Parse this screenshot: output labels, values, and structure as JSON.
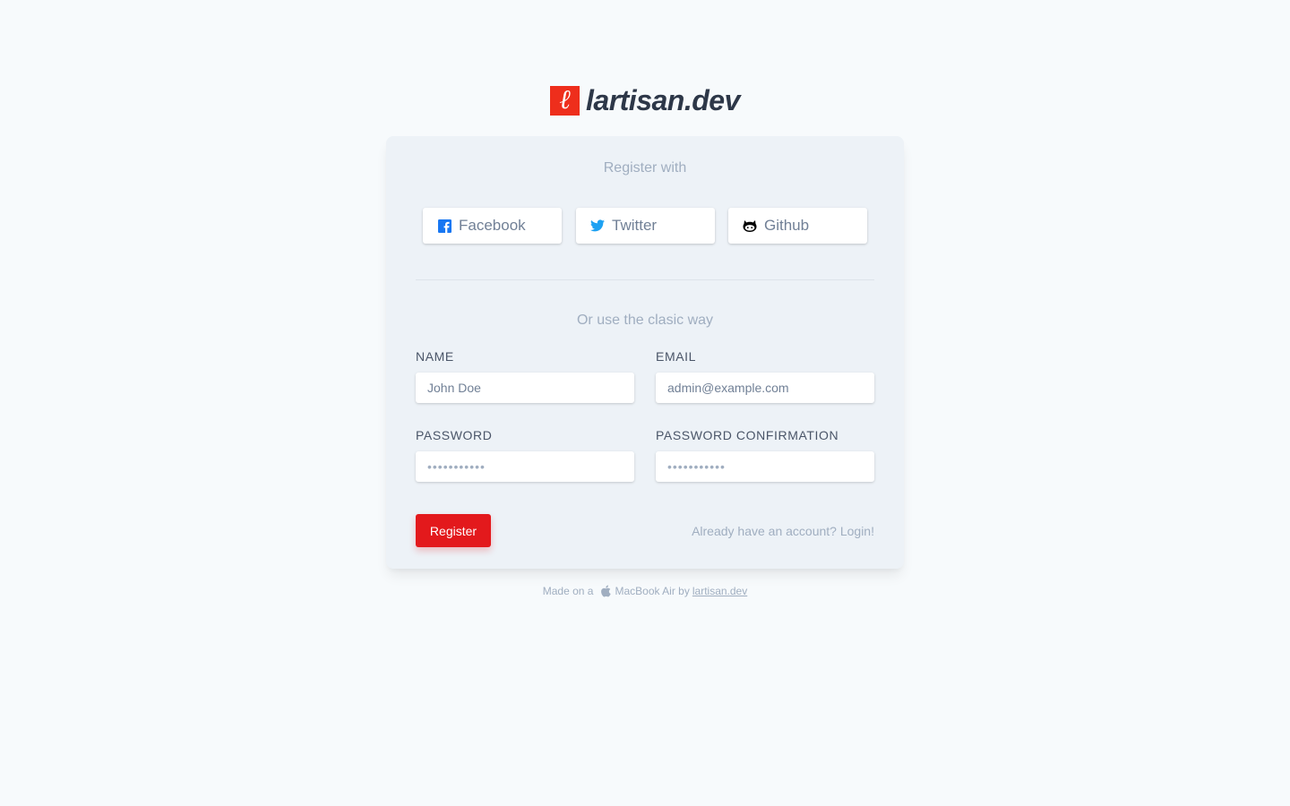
{
  "brand": {
    "logo_letter": "ℓ",
    "name": "lartisan.dev",
    "accent_color": "#ee2e1c"
  },
  "card": {
    "register_with": "Register with",
    "social": [
      {
        "label": "Facebook",
        "icon": "facebook-icon",
        "color": "#1877f2"
      },
      {
        "label": "Twitter",
        "icon": "twitter-icon",
        "color": "#1da1f2"
      },
      {
        "label": "Github",
        "icon": "github-icon",
        "color": "#000000"
      }
    ],
    "classic_text": "Or use the clasic way",
    "fields": {
      "name": {
        "label": "NAME",
        "placeholder": "John Doe"
      },
      "email": {
        "label": "EMAIL",
        "placeholder": "admin@example.com"
      },
      "password": {
        "label": "PASSWORD",
        "placeholder": "•••••••••••"
      },
      "password_confirmation": {
        "label": "PASSWORD CONFIRMATION",
        "placeholder": "•••••••••••"
      }
    },
    "register_button": "Register",
    "register_color": "#e3191c",
    "login_link": "Already have an account? Login!"
  },
  "footer": {
    "made_on": "Made on a",
    "device": "MacBook Air by",
    "link": "lartisan.dev"
  }
}
